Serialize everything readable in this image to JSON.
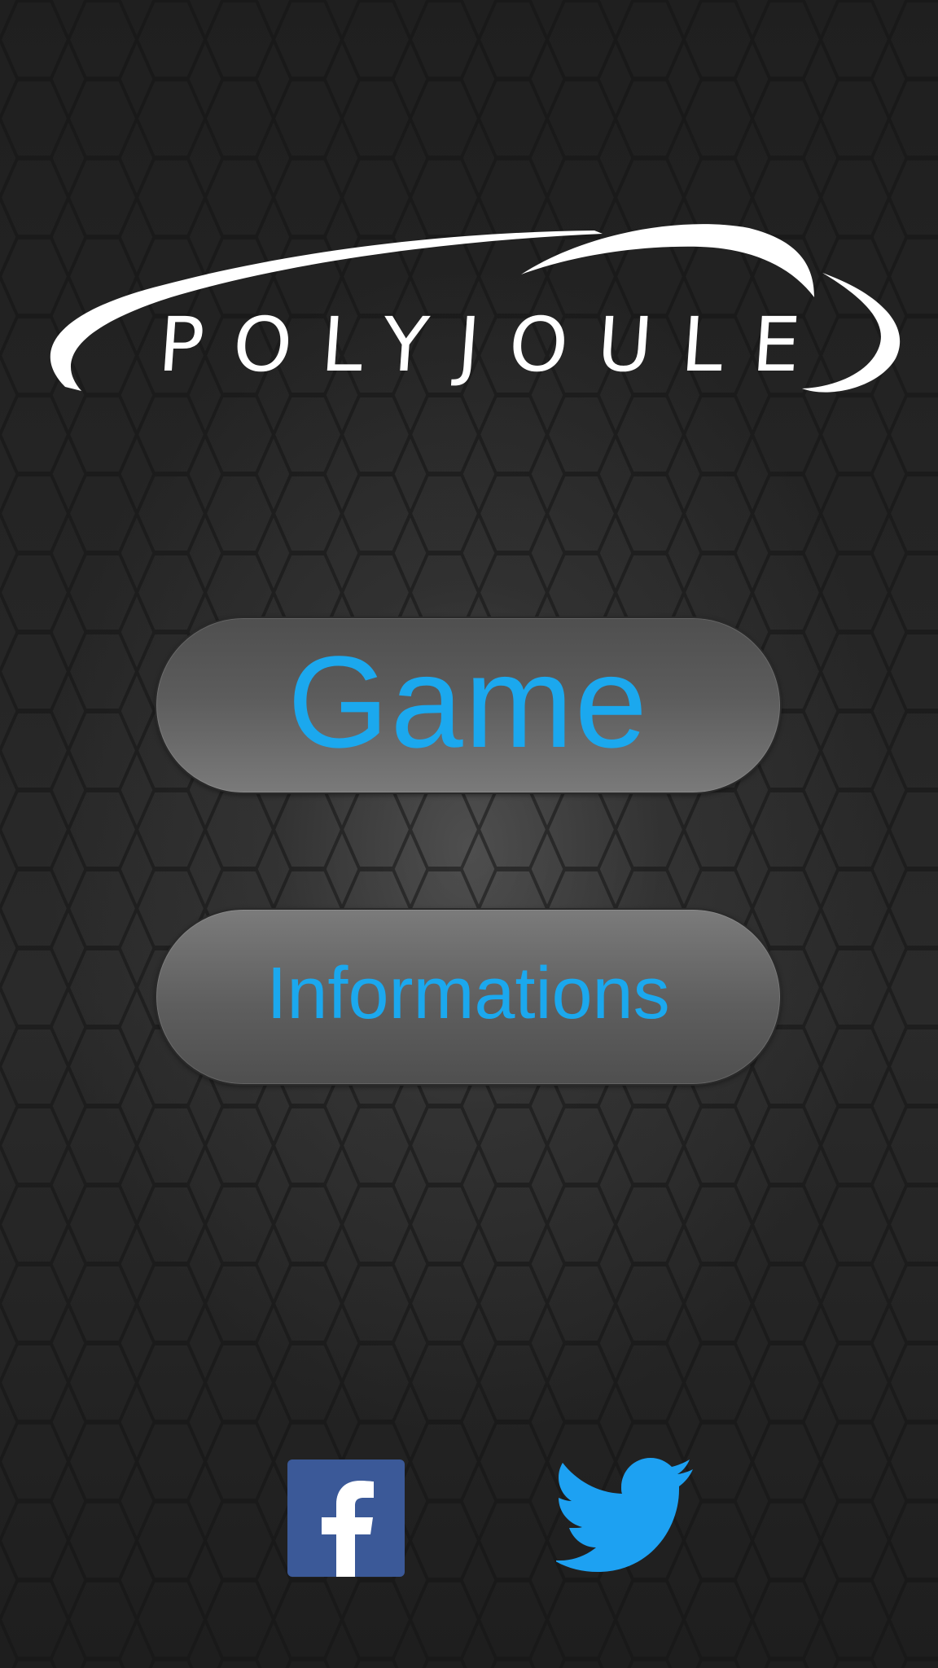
{
  "app": {
    "logo_text": "POLYJOULE"
  },
  "menu": {
    "game_label": "Game",
    "info_label": "Informations"
  },
  "social": {
    "facebook_icon": "facebook-icon",
    "twitter_icon": "twitter-icon"
  },
  "colors": {
    "accent": "#1ba8ee",
    "facebook": "#3b5998",
    "twitter": "#1da1f2",
    "background": "#232323"
  }
}
